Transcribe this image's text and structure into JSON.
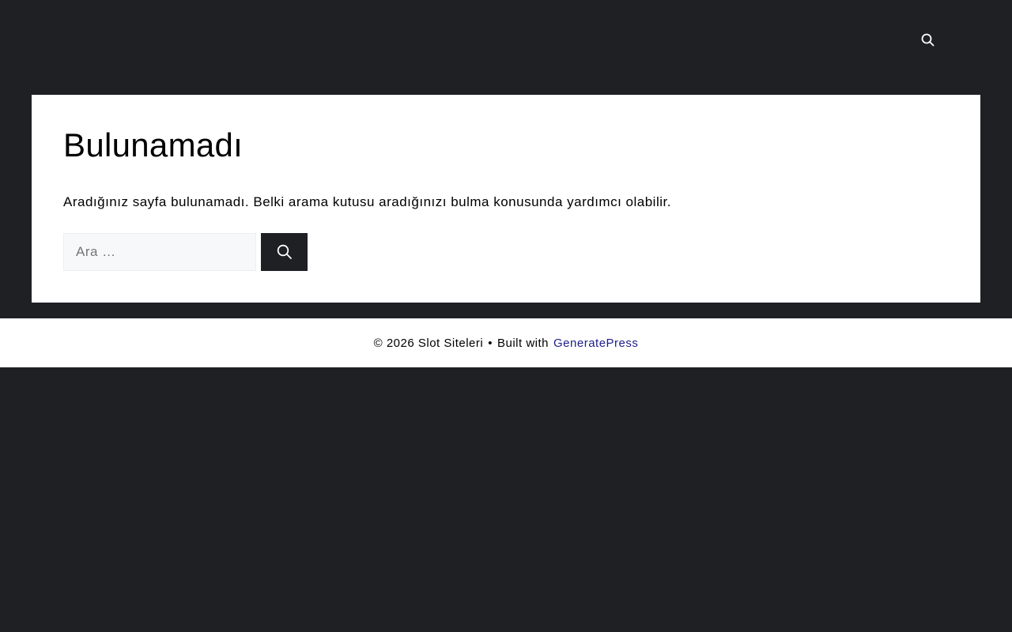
{
  "header": {
    "search_icon": "search-icon"
  },
  "main": {
    "title": "Bulunamadı",
    "message": "Aradığınız sayfa bulunamadı. Belki arama kutusu aradığınızı bulma konusunda yardımcı olabilir.",
    "search": {
      "placeholder": "Ara …",
      "value": "",
      "submit_icon": "search-icon"
    }
  },
  "footer": {
    "copyright": "© 2026 Slot Siteleri",
    "separator": "•",
    "built_with": "Built with",
    "link_text": "GeneratePress"
  },
  "colors": {
    "background": "#1f2024",
    "content": "#ffffff",
    "link": "#1e1e8a"
  }
}
